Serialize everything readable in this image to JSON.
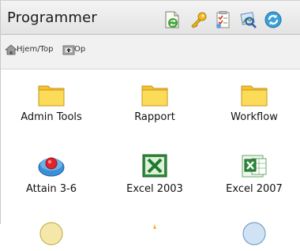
{
  "header": {
    "title": "Programmer",
    "icons": [
      "recycle-document-icon",
      "key-icon",
      "checklist-icon",
      "photo-search-icon",
      "refresh-icon"
    ]
  },
  "breadcrumb": {
    "home": "Hjem/Top",
    "up": "Op"
  },
  "items": [
    {
      "label": "Admin Tools",
      "icon": "folder-icon"
    },
    {
      "label": "Rapport",
      "icon": "folder-icon"
    },
    {
      "label": "Workflow",
      "icon": "folder-icon"
    },
    {
      "label": "Attain 3-6",
      "icon": "attain-icon"
    },
    {
      "label": "Excel 2003",
      "icon": "excel-2003-icon"
    },
    {
      "label": "Excel 2007",
      "icon": "excel-2007-icon"
    }
  ],
  "colors": {
    "folder": "#f9d54a",
    "excel_green": "#2f8a3a"
  }
}
